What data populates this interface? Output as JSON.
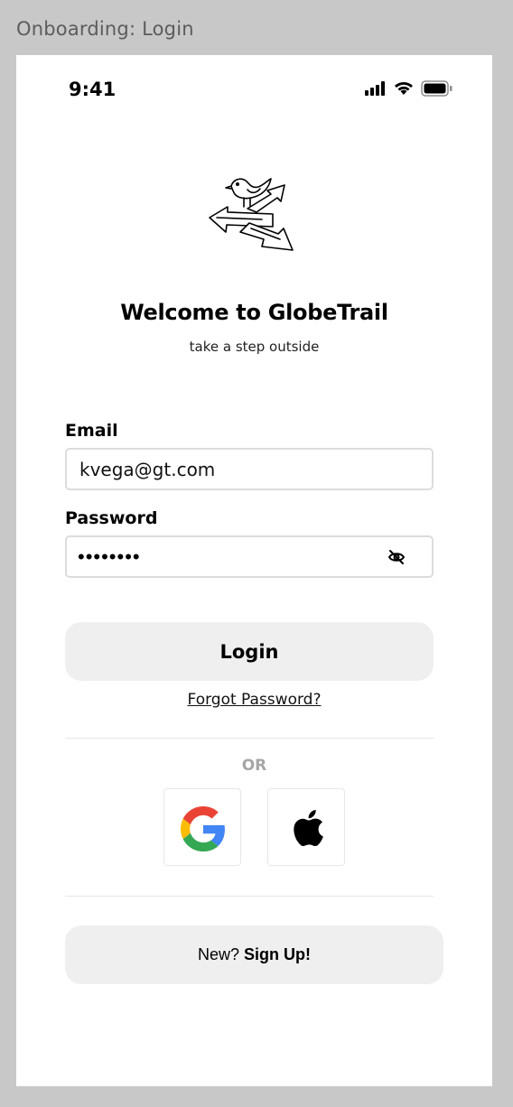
{
  "frame_title": "Onboarding: Login",
  "status_bar": {
    "time": "9:41",
    "icons": [
      "cellular-signal-icon",
      "wifi-icon",
      "battery-icon"
    ]
  },
  "logo": {
    "icon": "bird-on-signpost-logo"
  },
  "welcome": {
    "title": "Welcome to GlobeTrail",
    "tagline": "take a step outside"
  },
  "form": {
    "email": {
      "label": "Email",
      "value": "kvega@gt.com"
    },
    "password": {
      "label": "Password",
      "masked_value": "••••••••",
      "toggle_icon": "eye-slash-icon"
    }
  },
  "actions": {
    "login_label": "Login",
    "forgot_label": "Forgot Password?",
    "or_label": "OR",
    "social": [
      {
        "name": "google",
        "icon": "google-icon"
      },
      {
        "name": "apple",
        "icon": "apple-icon"
      }
    ],
    "signup_prefix": "New? ",
    "signup_label": "Sign Up!"
  },
  "colors": {
    "background": "#c8c8c8",
    "screen": "#ffffff",
    "button_fill": "#efefef",
    "input_border": "#dcdcdc",
    "muted_text": "#a6a6a6",
    "google_blue": "#4285F4",
    "google_red": "#EA4335",
    "google_yellow": "#FBBC05",
    "google_green": "#34A853"
  }
}
